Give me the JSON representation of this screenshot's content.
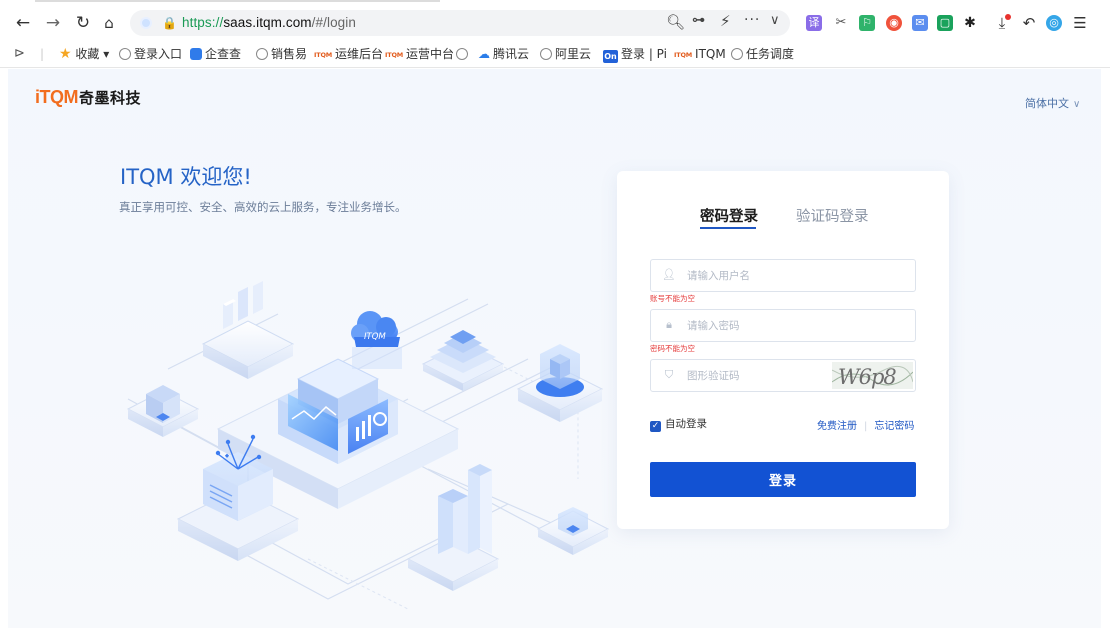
{
  "browser": {
    "url_protocol": "https://",
    "url_host": "saas.itqm.com",
    "url_path": "/#/login",
    "bookmarks": [
      {
        "label": "收藏 ▾"
      },
      {
        "label": "登录入口"
      },
      {
        "label": "企查查"
      },
      {
        "label": "销售易"
      },
      {
        "label": "运维后台"
      },
      {
        "label": "运营中台"
      },
      {
        "label": "腾讯云"
      },
      {
        "label": "阿里云"
      },
      {
        "label": "登录 | Pi"
      },
      {
        "label": "ITQM"
      },
      {
        "label": "任务调度"
      }
    ],
    "bookmark_badge": "On",
    "itqm_mini_tag": "ITQM"
  },
  "header": {
    "logo_text": "iTQM",
    "brand_cn": "奇墨科技",
    "language": "简体中文",
    "language_arrow": "∨"
  },
  "hero": {
    "title": "ITQM 欢迎您!",
    "slogan": "真正享用可控、安全、高效的云上服务，专注业务增长。",
    "cloud_label": "ITQM"
  },
  "login": {
    "tabs": [
      "密码登录",
      "验证码登录"
    ],
    "username_placeholder": "请输入用户名",
    "username_error": "账号不能为空",
    "password_placeholder": "请输入密码",
    "password_error": "密码不能为空",
    "captcha_placeholder": "图形验证码",
    "captcha_image_text": "W6p8",
    "remember_label": "自动登录",
    "register_link": "免费注册",
    "forgot_link": "忘记密码",
    "submit_label": "登录"
  },
  "colors": {
    "primary": "#1252d3",
    "brand_orange": "#f26d1e",
    "error": "#e53b3b"
  }
}
